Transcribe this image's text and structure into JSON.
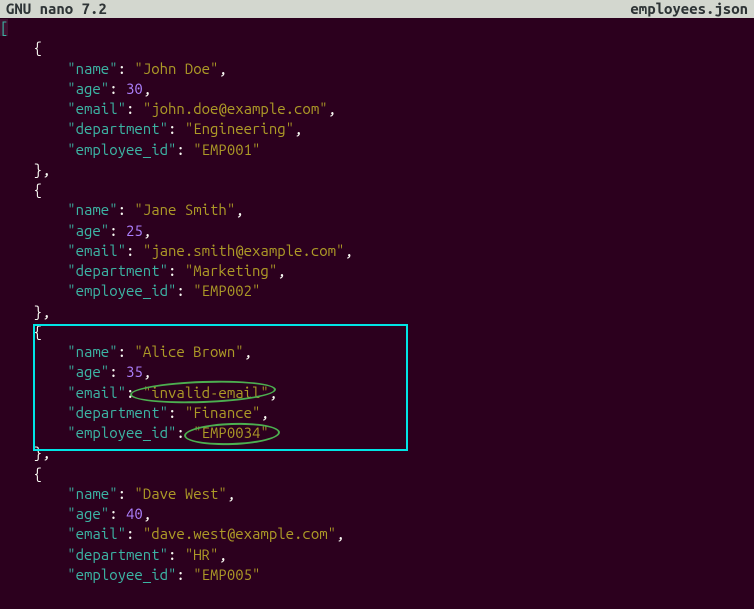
{
  "titlebar": {
    "app": "  GNU nano 7.2",
    "filename": "employees.json  "
  },
  "code": {
    "bracket_open": "[",
    "brace_open": "{",
    "brace_close_comma": "},",
    "emp1": {
      "name_k": "\"name\"",
      "name_v": "\"John Doe\"",
      "age_k": "\"age\"",
      "age_v": "30",
      "email_k": "\"email\"",
      "email_v": "\"john.doe@example.com\"",
      "dept_k": "\"department\"",
      "dept_v": "\"Engineering\"",
      "eid_k": "\"employee_id\"",
      "eid_v": "\"EMP001\""
    },
    "emp2": {
      "name_k": "\"name\"",
      "name_v": "\"Jane Smith\"",
      "age_k": "\"age\"",
      "age_v": "25",
      "email_k": "\"email\"",
      "email_v": "\"jane.smith@example.com\"",
      "dept_k": "\"department\"",
      "dept_v": "\"Marketing\"",
      "eid_k": "\"employee_id\"",
      "eid_v": "\"EMP002\""
    },
    "emp3": {
      "name_k": "\"name\"",
      "name_v": "\"Alice Brown\"",
      "age_k": "\"age\"",
      "age_v": "35",
      "email_k": "\"email\"",
      "email_v": "\"invalid-email\"",
      "dept_k": "\"department\"",
      "dept_v": "\"Finance\"",
      "eid_k": "\"employee_id\"",
      "eid_v": "\"EMP0034\""
    },
    "emp4": {
      "name_k": "\"name\"",
      "name_v": "\"Dave West\"",
      "age_k": "\"age\"",
      "age_v": "40",
      "email_k": "\"email\"",
      "email_v": "\"dave.west@example.com\"",
      "dept_k": "\"department\"",
      "dept_v": "\"HR\"",
      "eid_k": "\"employee_id\"",
      "eid_v": "\"EMP005\""
    }
  }
}
